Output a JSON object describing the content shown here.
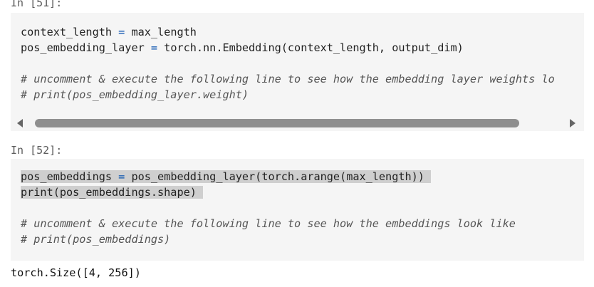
{
  "cells": [
    {
      "prompt": "In [51]:",
      "lines": {
        "l1a": "context_length ",
        "l1op": "=",
        "l1b": " max_length",
        "l2a": "pos_embedding_layer ",
        "l2op": "=",
        "l2b": " torch.nn.Embedding(context_length, output_dim)",
        "c1": "# uncomment & execute the following line to see how the embedding layer weights lo",
        "c2": "# print(pos_embedding_layer.weight)"
      }
    },
    {
      "prompt": "In [52]:",
      "lines": {
        "l1a": "pos_embeddings ",
        "l1op": "=",
        "l1b": " pos_embedding_layer(torch.arange(max_length))",
        "l2": "print(pos_embeddings.shape)",
        "c1": "# uncomment & execute the following line to see how the embeddings look like",
        "c2": "# print(pos_embeddings)"
      },
      "output": "torch.Size([4, 256])"
    }
  ]
}
